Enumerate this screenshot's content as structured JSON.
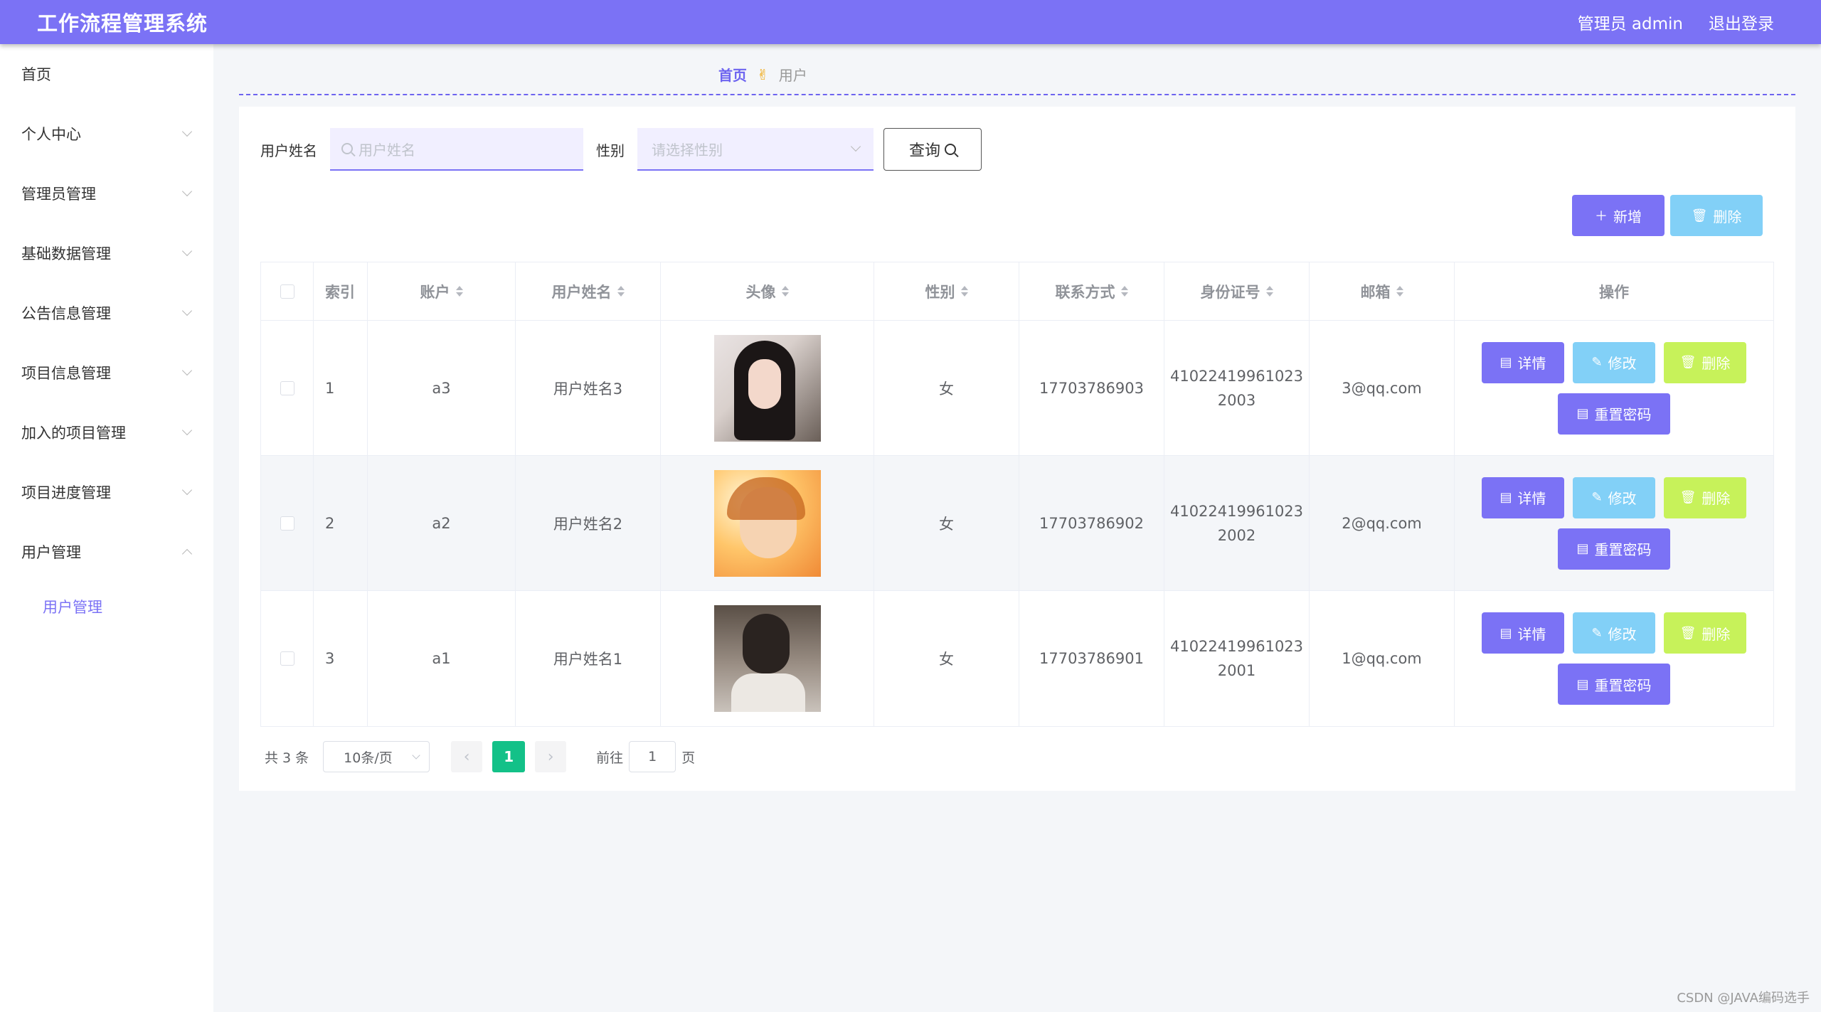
{
  "header": {
    "title": "工作流程管理系统",
    "user": "管理员 admin",
    "logout": "退出登录"
  },
  "sidebar": {
    "items": [
      {
        "label": "首页"
      },
      {
        "label": "个人中心"
      },
      {
        "label": "管理员管理"
      },
      {
        "label": "基础数据管理"
      },
      {
        "label": "公告信息管理"
      },
      {
        "label": "项目信息管理"
      },
      {
        "label": "加入的项目管理"
      },
      {
        "label": "项目进度管理"
      },
      {
        "label": "用户管理"
      }
    ],
    "subitem": "用户管理"
  },
  "breadcrumb": {
    "home": "首页",
    "separator": "✌",
    "current": "用户"
  },
  "search": {
    "name_label": "用户姓名",
    "name_placeholder": "用户姓名",
    "gender_label": "性别",
    "gender_placeholder": "请选择性别",
    "query_label": "查询"
  },
  "actions": {
    "add": "新增",
    "delete": "删除"
  },
  "table": {
    "headers": [
      "索引",
      "账户",
      "用户姓名",
      "头像",
      "性别",
      "联系方式",
      "身份证号",
      "邮箱",
      "操作"
    ],
    "rows": [
      {
        "index": "1",
        "account": "a3",
        "name": "用户姓名3",
        "gender": "女",
        "phone": "17703786903",
        "id_line1": "41022419961023",
        "id_line2": "2003",
        "email": "3@qq.com"
      },
      {
        "index": "2",
        "account": "a2",
        "name": "用户姓名2",
        "gender": "女",
        "phone": "17703786902",
        "id_line1": "41022419961023",
        "id_line2": "2002",
        "email": "2@qq.com"
      },
      {
        "index": "3",
        "account": "a1",
        "name": "用户姓名1",
        "gender": "女",
        "phone": "17703786901",
        "id_line1": "41022419961023",
        "id_line2": "2001",
        "email": "1@qq.com"
      }
    ],
    "ops": {
      "detail": "详情",
      "edit": "修改",
      "delete": "删除",
      "reset": "重置密码"
    }
  },
  "pagination": {
    "total": "共 3 条",
    "page_size": "10条/页",
    "current_page": "1",
    "goto_label": "前往",
    "goto_value": "1",
    "page_unit": "页"
  },
  "watermark": "CSDN @JAVA编码选手",
  "colors": {
    "accent": "#7b72f5",
    "info": "#82d0f7",
    "warning": "#c7f25a",
    "page_active": "#13c188"
  }
}
